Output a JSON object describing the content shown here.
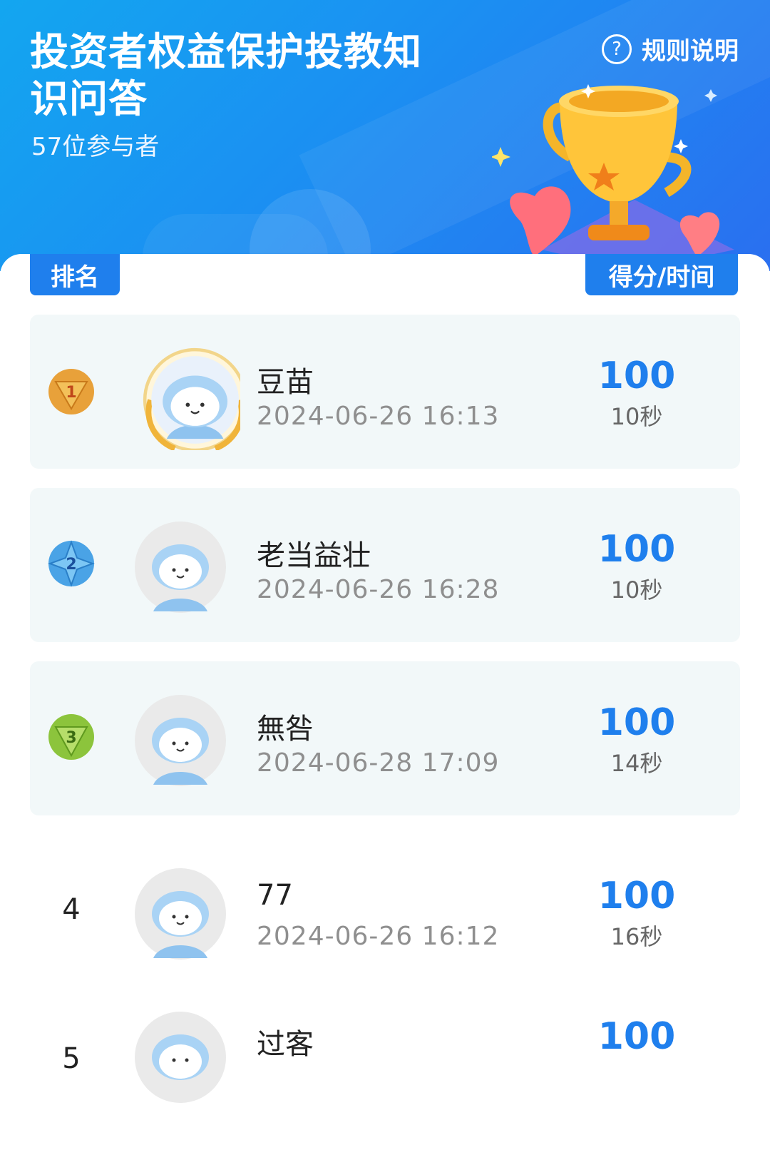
{
  "header": {
    "title": "投资者权益保护投教知识问答",
    "participants": "57位参与者",
    "rules_label": "规则说明"
  },
  "table_headers": {
    "rank": "排名",
    "score_time": "得分/时间"
  },
  "colors": {
    "accent": "#1f7fed",
    "header_gradient_start": "#13a6f0",
    "header_gradient_end": "#2a6ff0",
    "row_bg": "#f2f8f9",
    "gold": "#e8a13a",
    "silver_blue": "#4aa3e6",
    "bronze_green": "#8cc43c"
  },
  "leaderboard": [
    {
      "rank": "1",
      "medal": "gold-medal-icon",
      "name": "豆苗",
      "date": "2024-06-26 16:13",
      "score": "100",
      "time": "10秒"
    },
    {
      "rank": "2",
      "medal": "blue-medal-icon",
      "name": "老当益壮",
      "date": "2024-06-26 16:28",
      "score": "100",
      "time": "10秒"
    },
    {
      "rank": "3",
      "medal": "green-medal-icon",
      "name": "無咎",
      "date": "2024-06-28 17:09",
      "score": "100",
      "time": "14秒"
    },
    {
      "rank": "4",
      "name": "77",
      "date": "2024-06-26 16:12",
      "score": "100",
      "time": "16秒"
    },
    {
      "rank": "5",
      "name": "过客",
      "date": "",
      "score": "100",
      "time": ""
    }
  ]
}
